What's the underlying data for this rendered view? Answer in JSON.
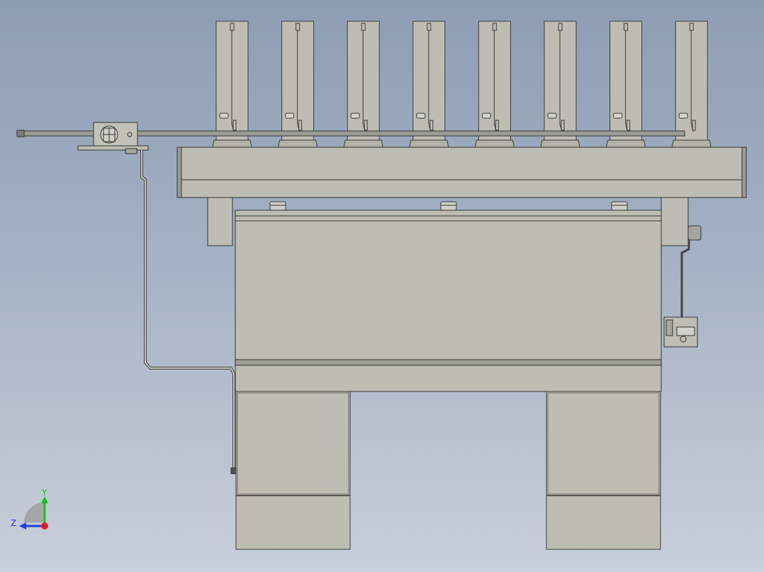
{
  "viewport": {
    "background_top": "#8d9db3",
    "background_bottom": "#c9cfdb",
    "part_fill": "#bdbdb3",
    "part_edge": "#3a3a3a"
  },
  "triad": {
    "y_label": "Y",
    "z_label": "Z",
    "y_color": "#19c219",
    "z_color": "#1f3fd6",
    "x_color": "#e02020",
    "icon": "view-orientation-triad-icon"
  },
  "model": {
    "cartridge_count": 8,
    "bolt_count": 3,
    "leg_count": 2
  }
}
